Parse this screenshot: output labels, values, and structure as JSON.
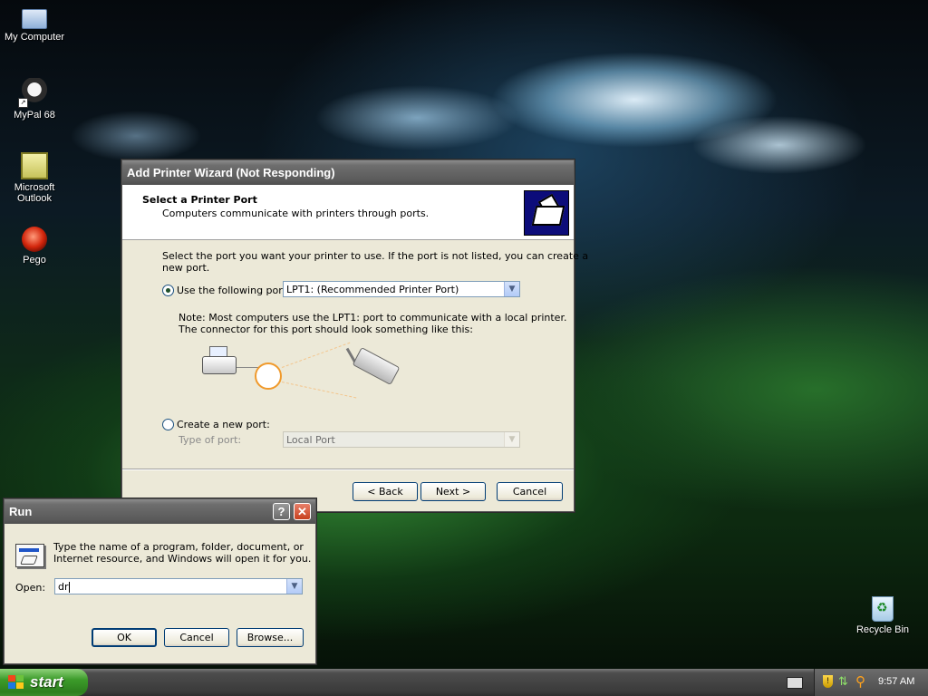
{
  "desktop": {
    "icons": [
      {
        "label": "My Computer"
      },
      {
        "label": "MyPal 68"
      },
      {
        "label": "Microsoft Outlook"
      },
      {
        "label": "Pego"
      },
      {
        "label": "Recycle Bin"
      }
    ]
  },
  "wizard": {
    "title": "Add Printer Wizard (Not Responding)",
    "header_title": "Select a Printer Port",
    "header_subtitle": "Computers communicate with printers through ports.",
    "intro": "Select the port you want your printer to use.  If the port is not listed, you can create a",
    "intro_2": "new port.",
    "use_port_label": "Use the following port:",
    "use_port_selected": true,
    "port_value": "LPT1: (Recommended Printer Port)",
    "note_1": "Note: Most computers use the LPT1: port to communicate with a local printer.",
    "note_2": "The connector for this port should look something like this:",
    "create_port_label": "Create a new port:",
    "type_of_port_label": "Type of port:",
    "type_of_port_value": "Local Port",
    "back_label": "< Back",
    "next_label": "Next >",
    "cancel_label": "Cancel"
  },
  "run": {
    "title": "Run",
    "help_glyph": "?",
    "close_glyph": "✕",
    "description_1": "Type the name of a program, folder, document, or",
    "description_2": "Internet resource, and Windows will open it for you.",
    "open_label": "Open:",
    "open_value": "dr",
    "ok_label": "OK",
    "cancel_label": "Cancel",
    "browse_label": "Browse..."
  },
  "taskbar": {
    "start_label": "start",
    "clock": "9:57 AM"
  },
  "colors": {
    "start_green": "#3c9b2a",
    "selection_border": "#003c74",
    "port_highlight": "#f09a2c"
  }
}
